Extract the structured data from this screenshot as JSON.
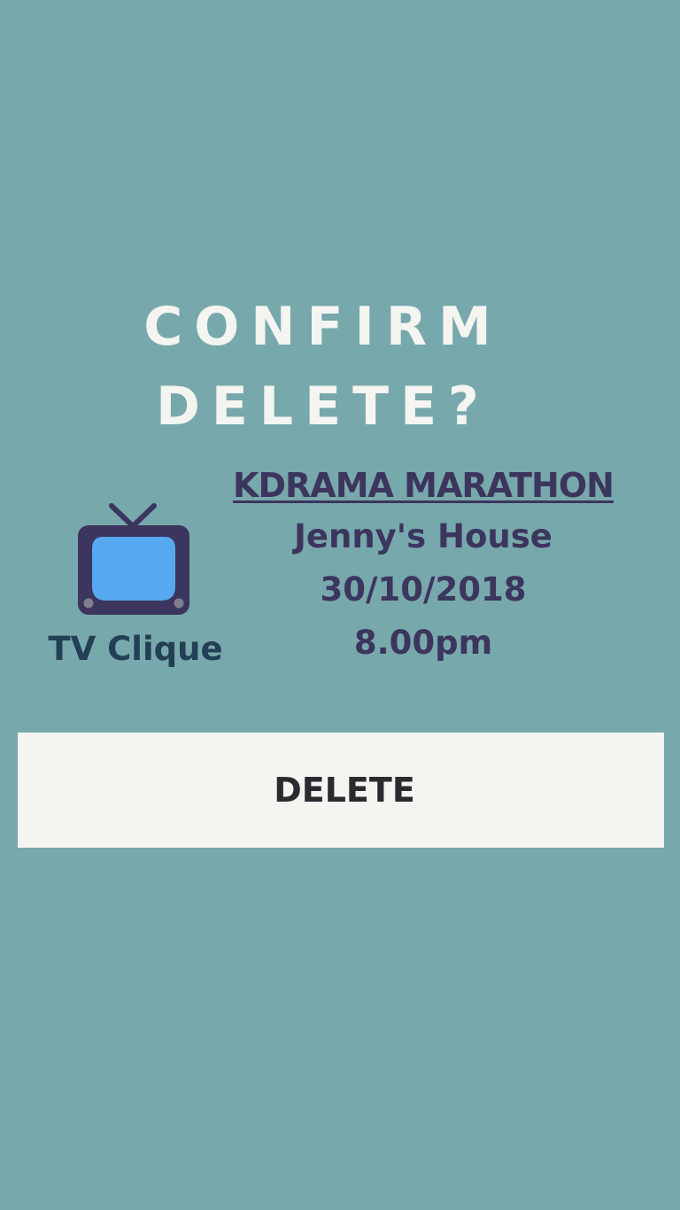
{
  "dialog": {
    "title_line1": "CONFIRM",
    "title_line2": "DELETE?"
  },
  "group": {
    "icon": "tv-icon",
    "name": "TV Clique"
  },
  "event": {
    "name": "KDRAMA MARATHON",
    "location": "Jenny's House",
    "date": "30/10/2018",
    "time": "8.00pm"
  },
  "actions": {
    "delete_label": "DELETE"
  },
  "colors": {
    "background": "#77a8ab",
    "title": "#f4f4f1",
    "event_text": "#3c355e",
    "group_text": "#233f55",
    "button_bg": "#f4f4f1",
    "button_text": "#2a2a2f",
    "tv_body": "#3c355e",
    "tv_screen": "#56a8f0"
  }
}
